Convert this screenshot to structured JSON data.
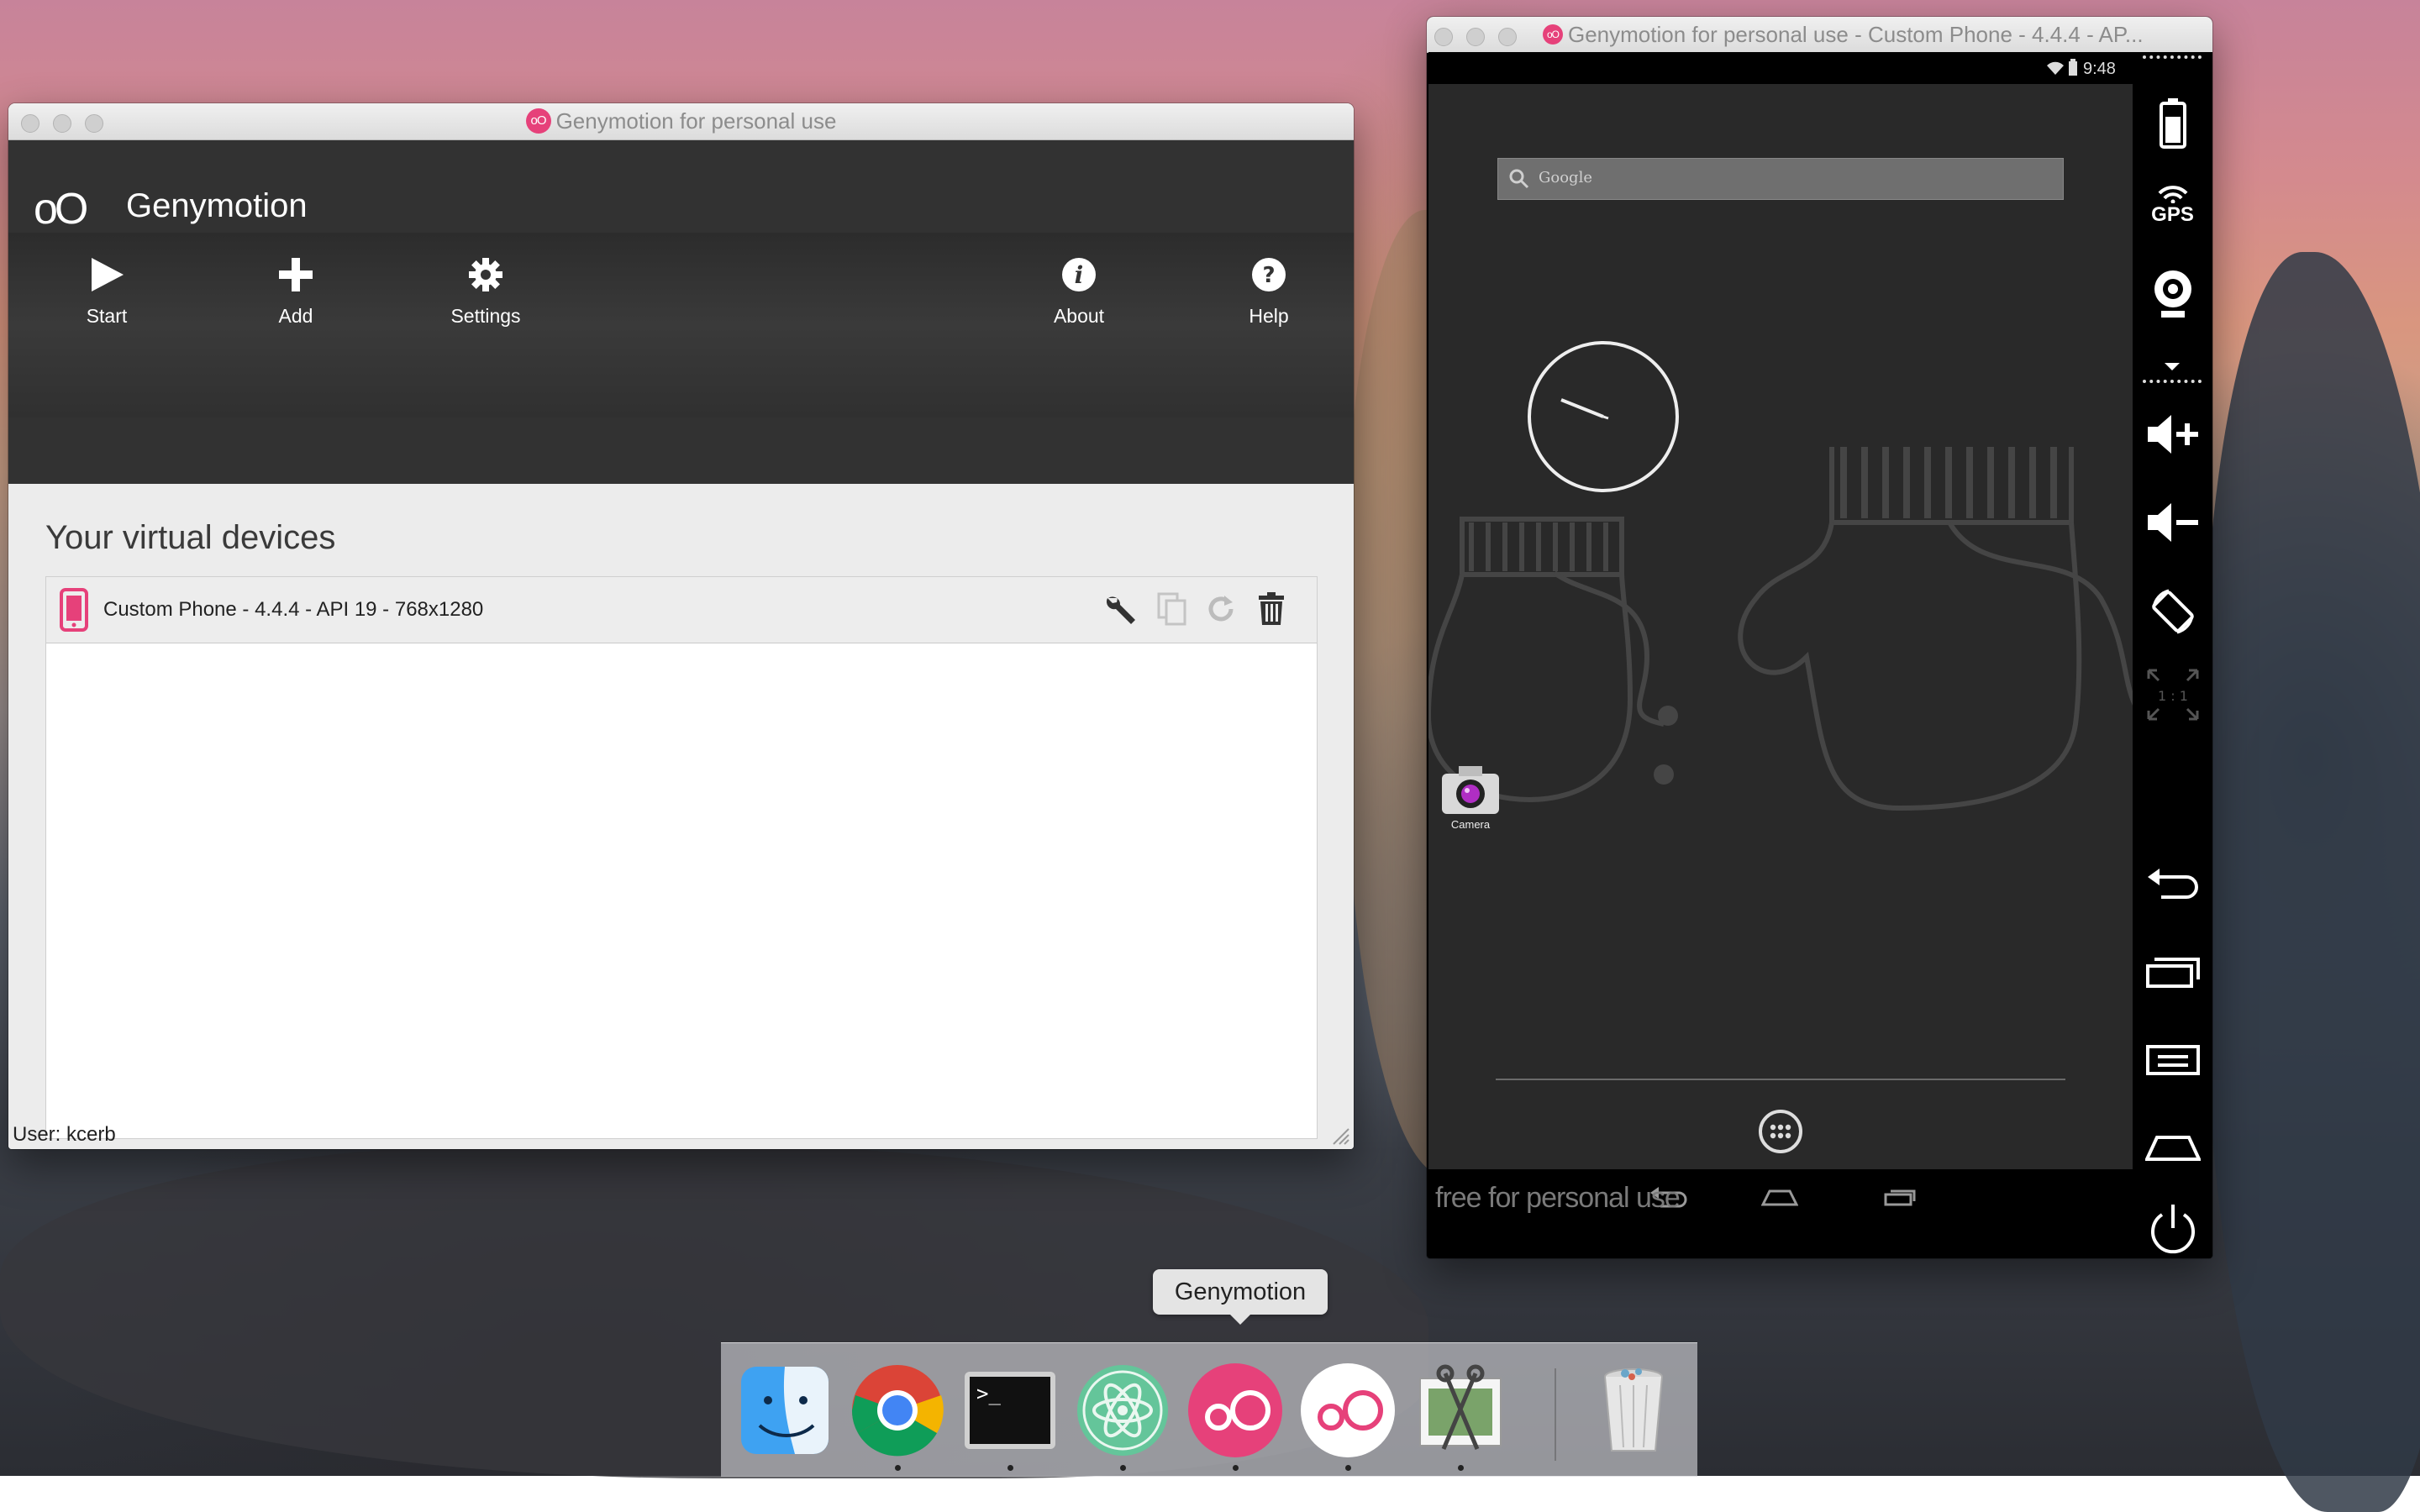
{
  "launcher": {
    "window_title": "Genymotion for personal use",
    "logo": "oO",
    "app_title": "Genymotion",
    "toolbar": {
      "start": "Start",
      "add": "Add",
      "settings": "Settings",
      "about": "About",
      "help": "Help"
    },
    "section_title": "Your virtual devices",
    "devices": [
      {
        "name": "Custom Phone - 4.4.4 - API 19 - 768x1280"
      }
    ],
    "user_line": "User: kcerb"
  },
  "phone": {
    "window_title": "Genymotion for personal use - Custom Phone - 4.4.4 - AP...",
    "status_time": "9:48",
    "search_placeholder": "Google",
    "app_label": "Camera",
    "watermark": "free for personal use",
    "sidebar": {
      "gps": "GPS",
      "scale": "1 : 1"
    }
  },
  "dock": {
    "tooltip": "Genymotion",
    "items": [
      "Finder",
      "Google Chrome",
      "Terminal",
      "Atom",
      "Genymotion",
      "Genymotion Player",
      "Preview",
      "Trash"
    ]
  },
  "colors": {
    "accent": "#e6417a",
    "header_bg": "#323232",
    "phone_bg": "#292929"
  }
}
